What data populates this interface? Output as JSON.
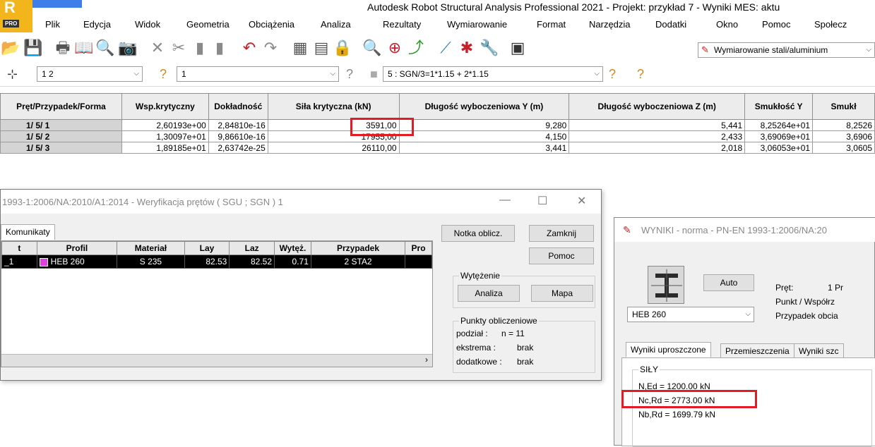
{
  "app": {
    "logo_letter": "R",
    "logo_badge": "PRO",
    "title": "Autodesk Robot Structural Analysis Professional 2021 - Projekt: przykład 7 - Wyniki MES: aktu"
  },
  "menu": [
    "Plik",
    "Edycja",
    "Widok",
    "Geometria",
    "Obciążenia",
    "Analiza",
    "Rezultaty",
    "Wymiarowanie",
    "Format",
    "Narzędzia",
    "Dodatki",
    "Okno",
    "Pomoc",
    "Społecz"
  ],
  "toolbar1": {
    "icons": [
      "open-icon",
      "save-icon",
      "print-icon",
      "preview-icon",
      "print-preview-icon",
      "screen-capture-icon",
      "delete-icon",
      "cut-icon",
      "copy-icon",
      "paste-icon",
      "undo-icon",
      "redo-icon",
      "calculator-icon",
      "table-icon",
      "lock-icon",
      "zoom-icon",
      "zoom-window-icon",
      "pan-icon",
      "structure-icon",
      "load-icon",
      "tools-icon",
      "layout-icon"
    ],
    "module_select": "Wymiarowanie stali/aluminium"
  },
  "toolbar2": {
    "bar_select": "1 2",
    "mode_select": "1",
    "case_select": "5 : SGN/3=1*1.15 + 2*1.15"
  },
  "grid": {
    "columns": [
      "Pręt/Przypadek/Forma",
      "Wsp.krytyczny",
      "Dokładność",
      "Siła krytyczna (kN)",
      "Długość wyboczeniowa Y (m)",
      "Długość wyboczeniowa Z (m)",
      "Smukłość Y",
      "Smukł"
    ],
    "rows": [
      [
        "1/    5/    1",
        "2,60193e+00",
        "2,84810e-16",
        "3591,00",
        "9,280",
        "5,441",
        "8,25264e+01",
        "8,2526"
      ],
      [
        "1/    5/    2",
        "1,30097e+01",
        "9,86610e-16",
        "17955,00",
        "4,150",
        "2,433",
        "3,69069e+01",
        "3,6906"
      ],
      [
        "1/    5/    3",
        "1,89185e+01",
        "2,63742e-25",
        "26110,00",
        "3,441",
        "2,018",
        "3,06053e+01",
        "3,0605"
      ]
    ]
  },
  "verif_dialog": {
    "title": "1993-1:2006/NA:2010/A1:2014 - Weryfikacja prętów ( SGU ; SGN ) 1",
    "tab": "Komunikaty",
    "columns": [
      "t",
      "Profil",
      "Materiał",
      "Lay",
      "Laz",
      "Wytęż.",
      "Przypadek",
      "Pro"
    ],
    "row": [
      "_1",
      "HEB 260",
      "S 235",
      "82.53",
      "82.52",
      "0.71",
      "2 STA2",
      ""
    ],
    "buttons": {
      "notka": "Notka oblicz.",
      "zamknij": "Zamknij",
      "pomoc": "Pomoc",
      "analiza": "Analiza",
      "mapa": "Mapa"
    },
    "wytezenie_title": "Wytężenie",
    "punkty_title": "Punkty obliczeniowe",
    "podzial_label": "podział :",
    "podzial_value": "n = 11",
    "ekstrema_label": "ekstrema :",
    "ekstrema_value": "brak",
    "dodatkowe_label": "dodatkowe :",
    "dodatkowe_value": "brak"
  },
  "wyniki_dialog": {
    "title": "WYNIKI - norma - PN-EN 1993-1:2006/NA:20",
    "auto_btn": "Auto",
    "profile_select": "HEB 260",
    "pret_label": "Pręt:",
    "pret_value": "1  Pr",
    "punkt_label": "Punkt / Współrz",
    "przypadek_label": "Przypadek obcia",
    "tabs": [
      "Wyniki uproszczone",
      "Przemieszczenia",
      "Wyniki szc"
    ],
    "sily_title": "SIŁY",
    "ned": "N,Ed = 1200.00 kN",
    "ncrd": "Nc,Rd = 2773.00 kN",
    "nbrd": "Nb,Rd = 1699.79 kN"
  },
  "colors": {
    "highlight": "#e21b24",
    "row_selected_bg": "#000000",
    "header_bg": "#ececec"
  }
}
